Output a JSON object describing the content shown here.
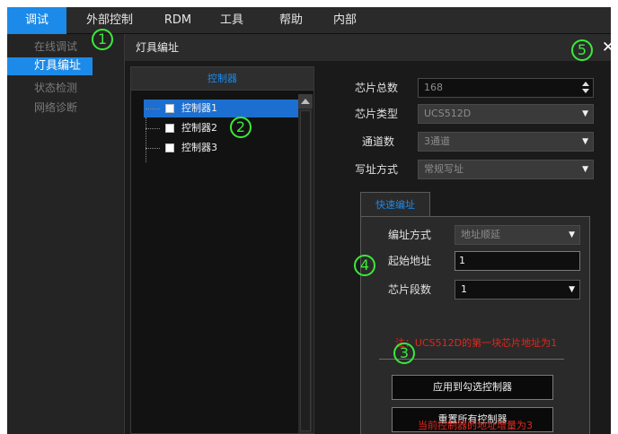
{
  "menubar": {
    "items": [
      {
        "label": "调试"
      },
      {
        "label": "外部控制"
      },
      {
        "label": "RDM"
      },
      {
        "label": "工具"
      },
      {
        "label": "帮助"
      },
      {
        "label": "内部"
      }
    ],
    "active_index": 0
  },
  "leftnav": {
    "items": [
      {
        "label": "在线调试"
      },
      {
        "label": "灯具编址"
      },
      {
        "label": "状态检测"
      },
      {
        "label": "网络诊断"
      }
    ],
    "active_index": 1
  },
  "dialog": {
    "title": "灯具编址",
    "close_label": "✕"
  },
  "controller_panel": {
    "header": "控制器",
    "items": [
      {
        "label": "控制器1",
        "checked": false,
        "selected": true
      },
      {
        "label": "控制器2",
        "checked": false,
        "selected": false
      },
      {
        "label": "控制器3",
        "checked": false,
        "selected": false
      }
    ]
  },
  "settings": {
    "chip_total": {
      "label": "芯片总数",
      "value": "168"
    },
    "chip_type": {
      "label": "芯片类型",
      "value": "UCS512D"
    },
    "channel_count": {
      "label": "通道数",
      "value": "3通道"
    },
    "write_mode": {
      "label": "写址方式",
      "value": "常规写址"
    }
  },
  "quick_address": {
    "tab_label": "快速编址",
    "mode": {
      "label": "编址方式",
      "value": "地址顺延"
    },
    "start_address": {
      "label": "起始地址",
      "value": "1"
    },
    "chip_segments": {
      "label": "芯片段数",
      "value": "1"
    },
    "note": "注：UCS512D的第一块芯片地址为1",
    "apply_button": "应用到勾选控制器",
    "reset_button": "重置所有控制器",
    "status": "当前控制器的地址增量为3"
  },
  "markers": [
    "1",
    "2",
    "3",
    "4",
    "5"
  ],
  "colors": {
    "accent": "#1c8ae8",
    "marker": "#3bea3b",
    "warning": "#e0281c"
  }
}
